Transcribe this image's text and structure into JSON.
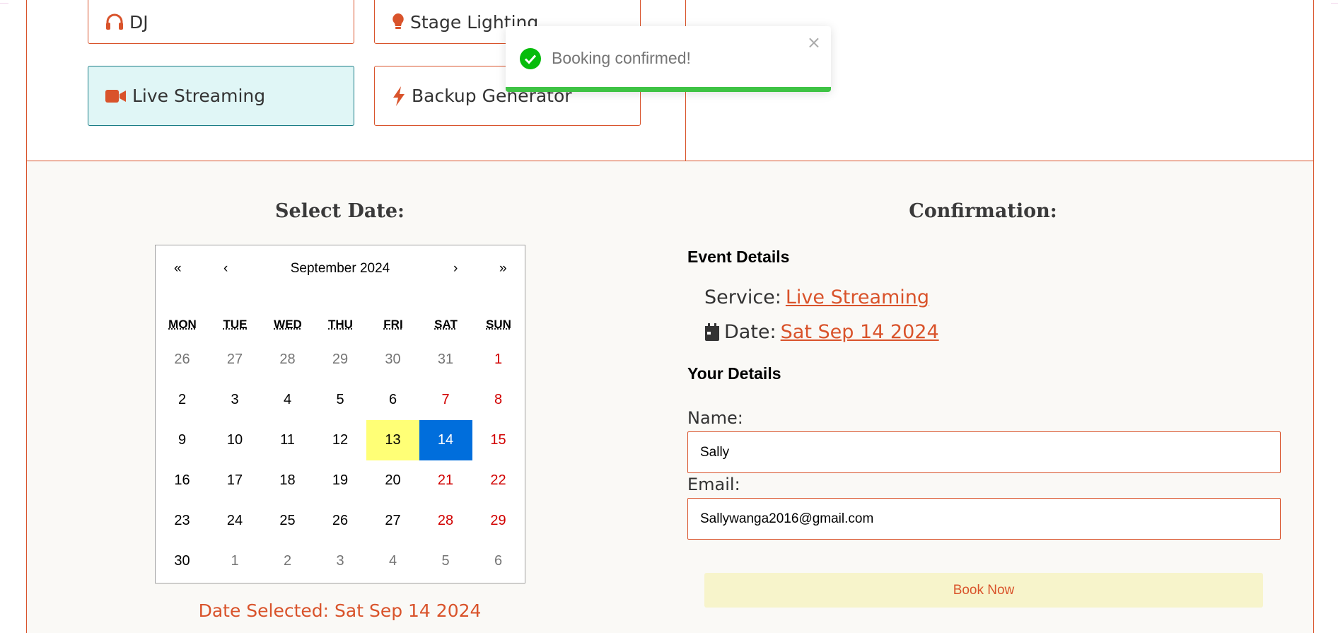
{
  "services": {
    "dj": "DJ",
    "stage_lighting": "Stage Lighting",
    "live_streaming": "Live Streaming",
    "backup_generator": "Backup Generator"
  },
  "toast": {
    "message": "Booking confirmed!",
    "close": "×",
    "progress": 1.0,
    "progress_color": "#3ec344"
  },
  "date_section": {
    "title": "Select Date:",
    "calendar": {
      "prev_year": "«",
      "prev_month": "‹",
      "label": "September 2024",
      "next_month": "›",
      "next_year": "»",
      "weekdays": [
        "MON",
        "TUE",
        "WED",
        "THU",
        "FRI",
        "SAT",
        "SUN"
      ],
      "weeks": [
        [
          "26",
          "27",
          "28",
          "29",
          "30",
          "31",
          "1"
        ],
        [
          "2",
          "3",
          "4",
          "5",
          "6",
          "7",
          "8"
        ],
        [
          "9",
          "10",
          "11",
          "12",
          "13",
          "14",
          "15"
        ],
        [
          "16",
          "17",
          "18",
          "19",
          "20",
          "21",
          "22"
        ],
        [
          "23",
          "24",
          "25",
          "26",
          "27",
          "28",
          "29"
        ],
        [
          "30",
          "1",
          "2",
          "3",
          "4",
          "5",
          "6"
        ]
      ],
      "today": "13",
      "selected": "14"
    },
    "date_selected": "Date Selected: Sat Sep 14 2024"
  },
  "confirmation": {
    "title": "Confirmation:",
    "event_details_heading": "Event Details",
    "service_label": "Service:",
    "service_value": "Live Streaming",
    "date_label": "Date:",
    "date_value": "Sat Sep 14 2024",
    "your_details_heading": "Your Details",
    "name_label": "Name:",
    "name_value": "Sally",
    "email_label": "Email:",
    "email_value": "Sallywanga2016@gmail.com",
    "book_button": "Book Now"
  },
  "colors": {
    "accent": "#d9532b",
    "selected_day": "#006edc",
    "today_day": "#ffff76",
    "weekend": "#d10000"
  }
}
